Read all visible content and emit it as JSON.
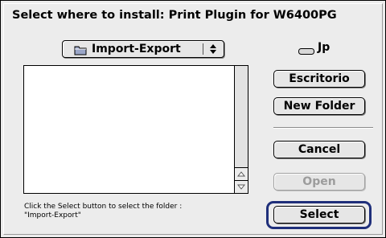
{
  "dialog": {
    "title": "Select where to install: Print Plugin for W6400PG"
  },
  "folder_popup": {
    "selected": "Import-Export",
    "icon": "folder-icon"
  },
  "disk": {
    "label": "Jp",
    "icon": "disk-icon"
  },
  "file_list": {
    "items": []
  },
  "buttons": {
    "desktop": "Escritorio",
    "new_folder": "New Folder",
    "cancel": "Cancel",
    "open": "Open",
    "select": "Select"
  },
  "hint": {
    "line1": "Click the Select button to select the folder :",
    "line2": "\"Import-Export\""
  },
  "colors": {
    "accent_ring": "#1f2f7a",
    "dialog_bg": "#ececec"
  }
}
